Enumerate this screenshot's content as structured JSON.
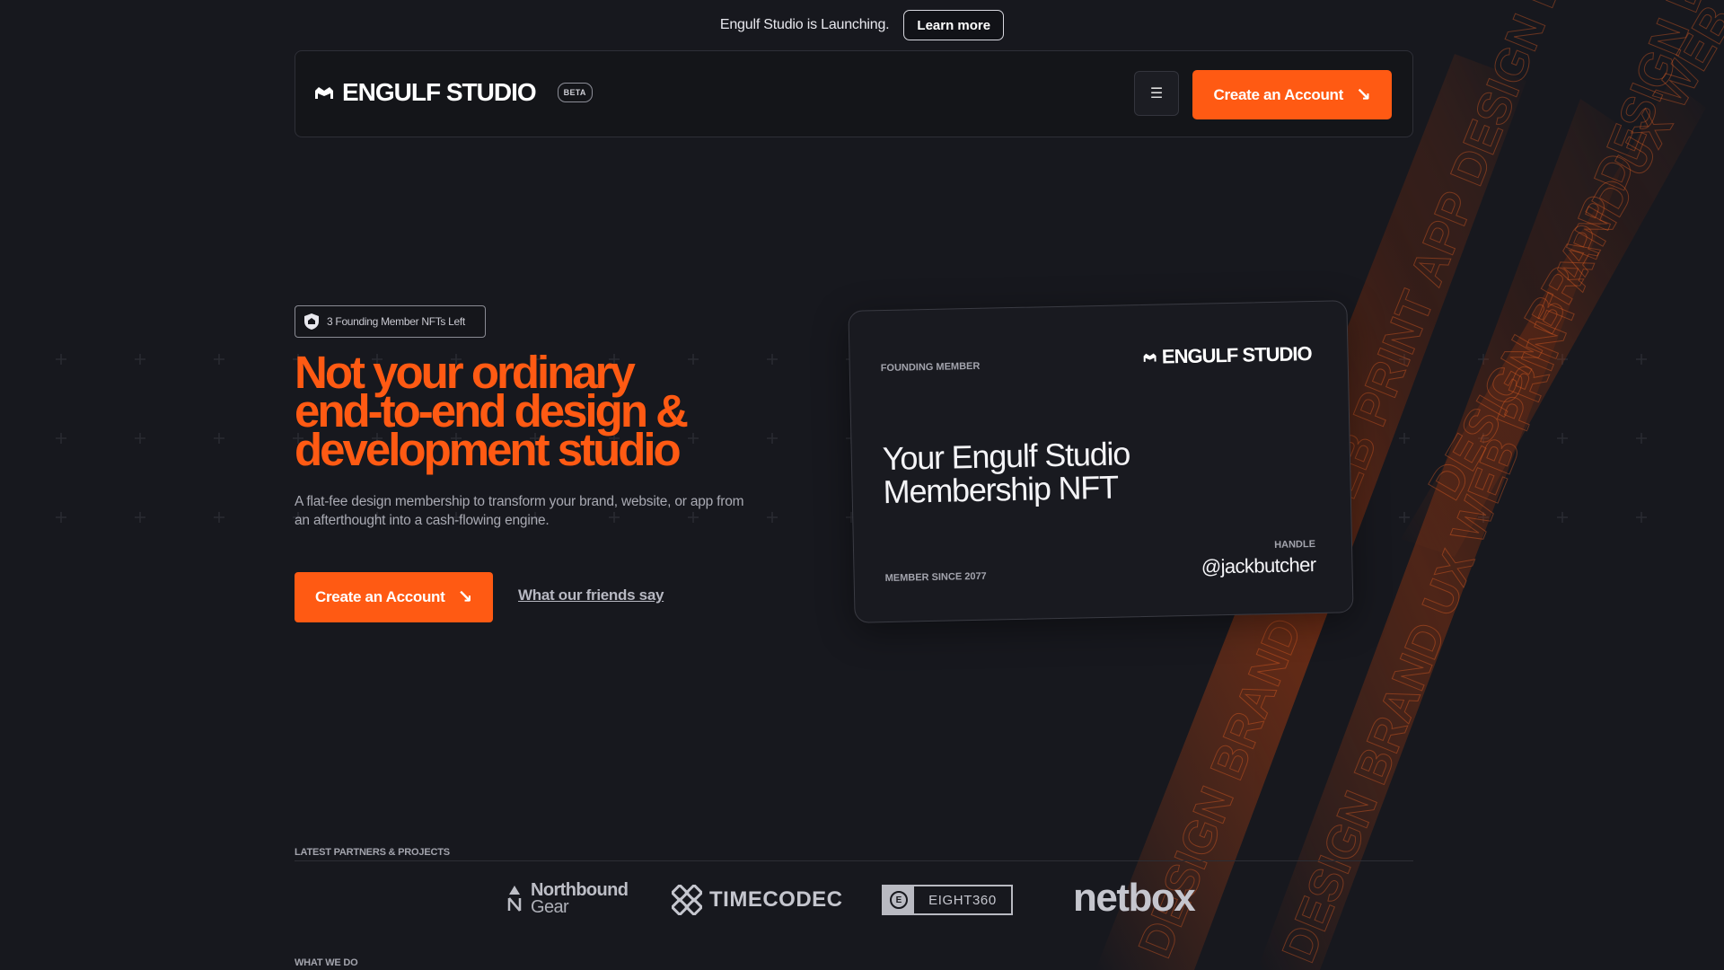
{
  "announcement": {
    "text": "Engulf Studio is Launching.",
    "button": "Learn more"
  },
  "navbar": {
    "brand": "ENGULF STUDIO",
    "badge": "BETA",
    "menu_icon": "hamburger-menu-icon",
    "cta_label": "Create an Account",
    "cta_icon": "arrow-down-right-icon"
  },
  "hero": {
    "pill_text": "3 Founding Member NFTs Left",
    "pill_icon": "shield-icon",
    "title_lines": [
      "Not your ordinary",
      "end-to-end design &",
      "development studio"
    ],
    "description": "A flat-fee design membership to transform your brand, website, or app from an afterthought into a cash-flowing engine.",
    "cta_label": "Create an Account",
    "secondary_link": "What our friends say"
  },
  "card": {
    "label": "FOUNDING MEMBER",
    "brand": "ENGULF STUDIO",
    "title": "Your Engulf Studio Membership NFT",
    "member_since": "MEMBER SINCE 2077",
    "handle_label": "HANDLE",
    "handle": "@jackbutcher"
  },
  "partners": {
    "label": "LATEST PARTNERS & PROJECTS",
    "logos": [
      {
        "name": "Northbound",
        "sub": "Gear"
      },
      {
        "name": "TIMECODEC"
      },
      {
        "name": "EIGHT360",
        "mark": "E"
      },
      {
        "name": "netbox"
      }
    ]
  },
  "sections": {
    "what_we_do": "WHAT WE DO"
  },
  "colors": {
    "background": "#17181e",
    "accent": "#ff5a13",
    "card": "#191a20"
  },
  "streak_text": "DESIGN BRAND UX WEB PRINT APP"
}
